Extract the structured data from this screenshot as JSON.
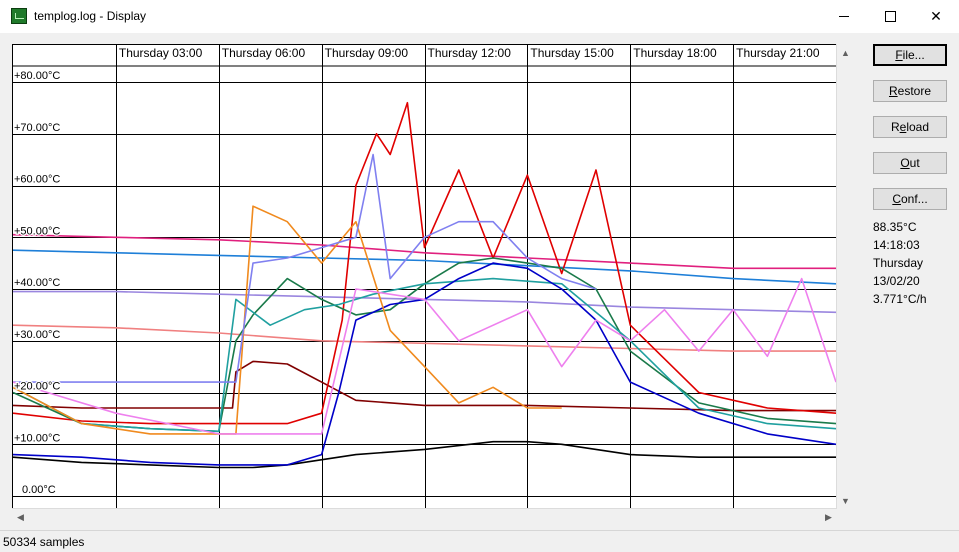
{
  "window": {
    "title": "templog.log - Display",
    "icon": "app-icon"
  },
  "buttons": [
    {
      "label": "File...",
      "access_key": "F",
      "rest": "ile..."
    },
    {
      "label": "Restore",
      "access_key": "R",
      "rest": "estore"
    },
    {
      "label": "Reload",
      "access_key": "e",
      "prefix": "R",
      "rest": "load"
    },
    {
      "label": "Out",
      "access_key": "O",
      "rest": "ut"
    },
    {
      "label": "Conf...",
      "access_key": "C",
      "rest": "onf..."
    }
  ],
  "readout": {
    "temperature": "88.35°C",
    "time": "14:18:03",
    "day": "Thursday",
    "date": "13/02/20",
    "rate": "3.771°C/h"
  },
  "status": {
    "samples": "50334 samples"
  },
  "chart_data": {
    "type": "line",
    "x_labels": [
      "Thursday 03:00",
      "Thursday 06:00",
      "Thursday 09:00",
      "Thursday 12:00",
      "Thursday 15:00",
      "Thursday 18:00",
      "Thursday 21:00"
    ],
    "y_labels": [
      "+80.00°C",
      "+70.00°C",
      "+60.00°C",
      "+50.00°C",
      "+40.00°C",
      "+30.00°C",
      "+20.00°C",
      "+10.00°C",
      "0.00°C"
    ],
    "y_ticks": [
      80,
      70,
      60,
      50,
      40,
      30,
      20,
      10,
      0
    ],
    "x_ticks": [
      3,
      6,
      9,
      12,
      15,
      18,
      21
    ],
    "xlim": [
      0,
      24
    ],
    "ylim": [
      0,
      80
    ],
    "grid": true,
    "series": [
      {
        "color": "#000000",
        "x": [
          0,
          1,
          2,
          4,
          6,
          7,
          8,
          10,
          12,
          14,
          15,
          16,
          17,
          18,
          20,
          22,
          24
        ],
        "y": [
          7.5,
          7,
          6.5,
          6,
          5.5,
          5.5,
          6,
          8,
          9,
          10.5,
          10.5,
          10,
          9,
          8,
          7.5,
          7.5,
          7.5
        ]
      },
      {
        "color": "#e0207e",
        "x": [
          0,
          3,
          6,
          9,
          12,
          15,
          18,
          21,
          24
        ],
        "y": [
          50.5,
          50,
          49.5,
          48.5,
          47,
          46,
          45,
          44,
          44
        ]
      },
      {
        "color": "#1e7fd8",
        "x": [
          0,
          3,
          6,
          9,
          12,
          15,
          18,
          21,
          24
        ],
        "y": [
          47.5,
          47,
          46.5,
          46,
          45.5,
          44.5,
          43.5,
          42,
          41
        ]
      },
      {
        "color": "#9a86df",
        "x": [
          0,
          3,
          6,
          9,
          12,
          15,
          18,
          21,
          24
        ],
        "y": [
          39.5,
          39.5,
          39,
          38.5,
          38,
          37.5,
          36.5,
          36,
          35.5
        ]
      },
      {
        "color": "#f08080",
        "x": [
          0,
          3,
          6,
          9,
          12,
          15,
          18,
          21,
          24
        ],
        "y": [
          33,
          32.5,
          31.5,
          30,
          29.5,
          29,
          28.5,
          28,
          28
        ]
      },
      {
        "color": "#800000",
        "x": [
          0,
          2,
          6.4,
          6.5,
          7,
          8,
          9,
          10,
          12,
          15,
          18,
          21,
          24
        ],
        "y": [
          17.5,
          17,
          17,
          24,
          26,
          25.5,
          22,
          18.5,
          17.5,
          17.5,
          17,
          16.5,
          16.5
        ]
      },
      {
        "color": "#e00000",
        "x": [
          0,
          2,
          4,
          6,
          8,
          9,
          9.6,
          10,
          10.6,
          11,
          11.5,
          12,
          13,
          14,
          15,
          16,
          17,
          17.5,
          18,
          20,
          22,
          24
        ],
        "y": [
          16,
          14.5,
          14,
          14,
          14,
          16,
          34,
          60,
          70,
          66,
          76,
          48,
          63,
          46,
          62,
          43,
          63,
          48,
          33,
          20,
          17,
          16
        ]
      },
      {
        "color": "#1a7a4a",
        "x": [
          0,
          2,
          4,
          6,
          6.5,
          7,
          8,
          9,
          10,
          11,
          12,
          13,
          14,
          15,
          16,
          17,
          18,
          20,
          22,
          24
        ],
        "y": [
          20,
          14,
          13,
          12.5,
          30,
          35,
          42,
          38,
          35,
          36,
          41,
          45,
          46,
          45,
          44,
          40,
          28,
          18,
          15,
          14
        ]
      },
      {
        "color": "#20a0a0",
        "x": [
          0,
          2,
          4,
          6,
          6.5,
          7.5,
          8.5,
          9.5,
          10.5,
          12,
          14,
          16,
          18,
          20,
          22,
          24
        ],
        "y": [
          21,
          14,
          13,
          12.5,
          38,
          33,
          36,
          37,
          39,
          41,
          42,
          41,
          30,
          17,
          14,
          13
        ]
      },
      {
        "color": "#0000c8",
        "x": [
          0,
          2,
          4,
          6,
          8,
          9,
          9.5,
          10,
          11,
          12,
          13,
          14,
          15,
          16,
          17,
          18,
          20,
          22,
          24
        ],
        "y": [
          8,
          7.5,
          6.5,
          6,
          6,
          8,
          20,
          34,
          37,
          38,
          42,
          45,
          44,
          40,
          34,
          22,
          16,
          12,
          10
        ]
      },
      {
        "color": "#f08a1e",
        "x": [
          0,
          2,
          4,
          6.5,
          7,
          8,
          9,
          10,
          11,
          12,
          13,
          14,
          15,
          16
        ],
        "y": [
          21,
          14,
          12,
          12,
          56,
          53,
          45,
          53,
          32,
          25,
          18,
          21,
          17,
          17
        ]
      },
      {
        "color": "#8080f0",
        "x": [
          0,
          6.5,
          7,
          8,
          9,
          10,
          10.5,
          11,
          12,
          13,
          14,
          15,
          16,
          17
        ],
        "y": [
          22,
          22,
          45,
          46,
          48,
          50,
          66,
          42,
          50,
          53,
          53,
          46,
          42,
          40
        ]
      },
      {
        "color": "#ee80ee",
        "x": [
          0,
          3,
          6,
          9,
          10,
          12,
          13,
          15,
          16,
          17,
          18,
          19,
          20,
          21,
          22,
          23,
          24
        ],
        "y": [
          22,
          16,
          12,
          12,
          40,
          38,
          30,
          36,
          25,
          34,
          30,
          36,
          28,
          36,
          27,
          42,
          22
        ]
      }
    ]
  }
}
